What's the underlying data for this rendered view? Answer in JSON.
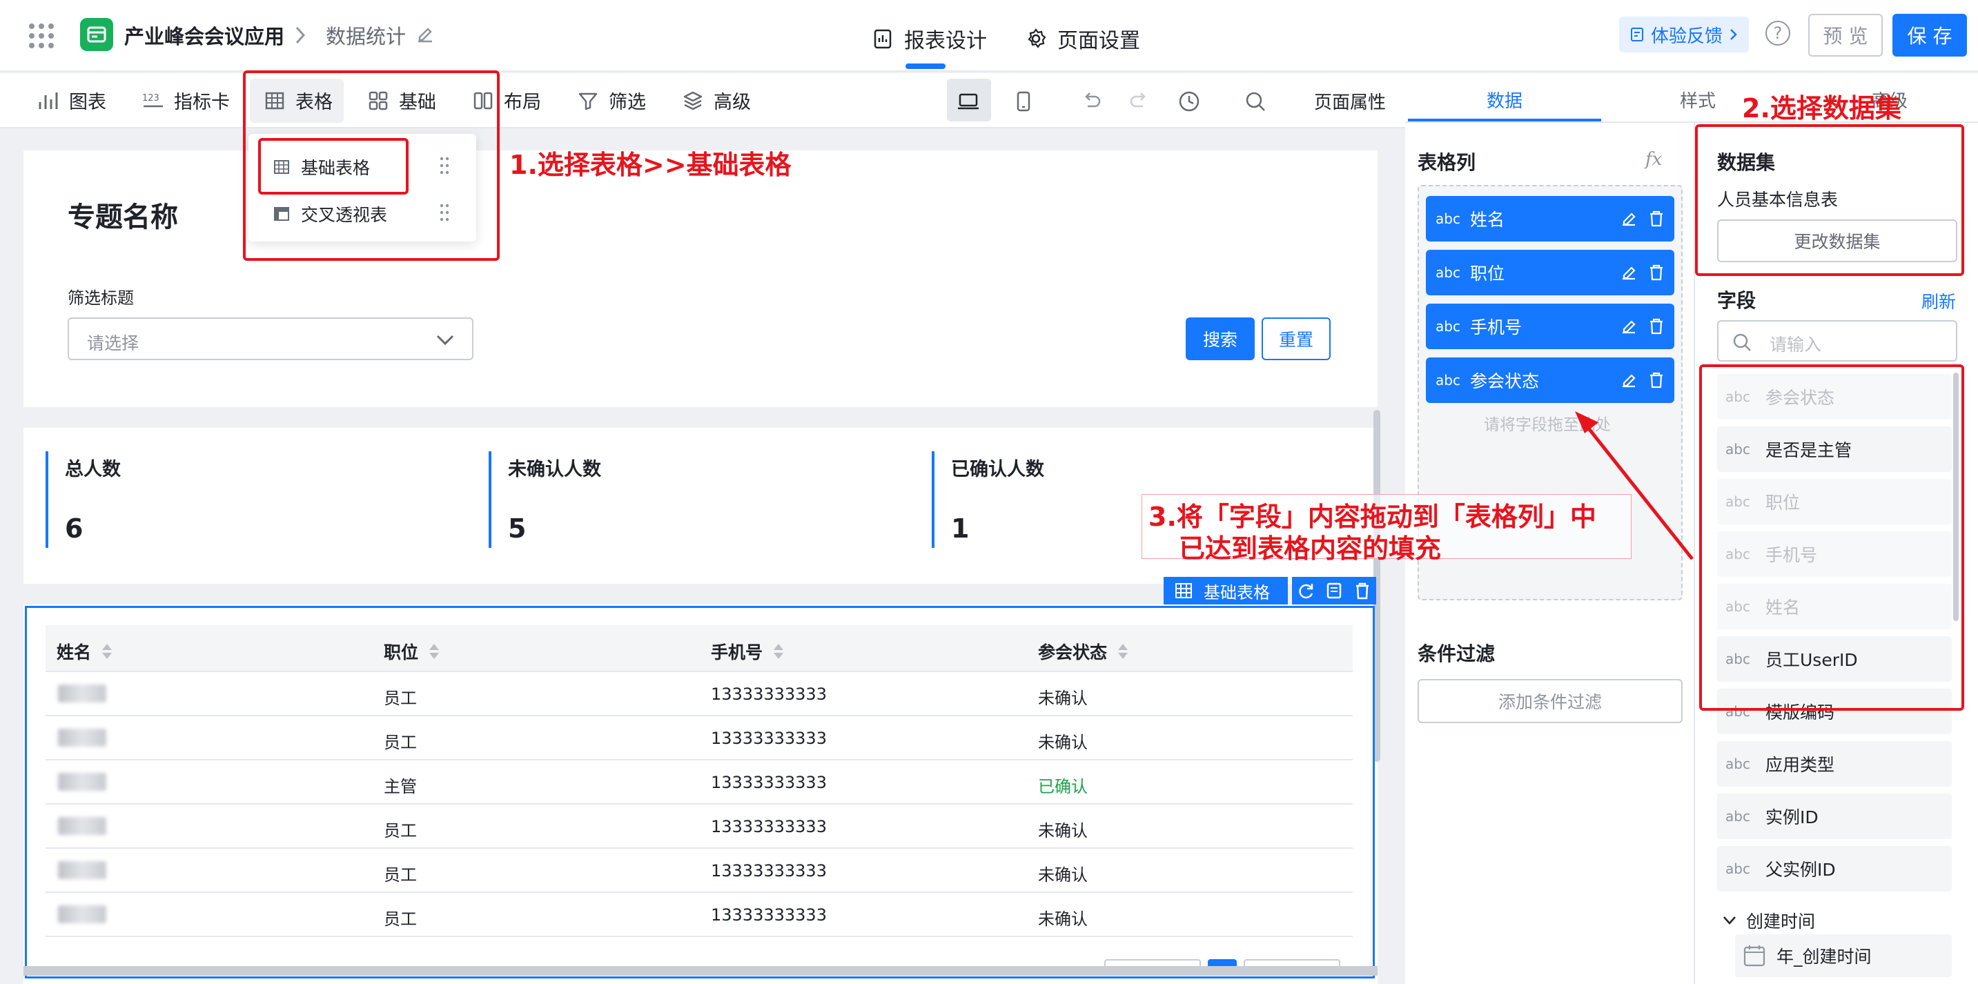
{
  "header": {
    "app_title": "产业峰会会议应用",
    "breadcrumb": "数据统计",
    "tabs": [
      {
        "label": "报表设计",
        "active": true
      },
      {
        "label": "页面设置",
        "active": false
      }
    ],
    "feedback": "体验反馈",
    "help": "?",
    "preview": "预 览",
    "save": "保 存"
  },
  "toolbar": {
    "items": [
      {
        "label": "图表",
        "icon": "bar-chart-icon"
      },
      {
        "label": "指标卡",
        "icon": "metric-123-icon"
      },
      {
        "label": "表格",
        "icon": "table-icon",
        "active": true
      },
      {
        "label": "基础",
        "icon": "basic-grid-icon"
      },
      {
        "label": "布局",
        "icon": "layout-icon"
      },
      {
        "label": "筛选",
        "icon": "filter-icon"
      },
      {
        "label": "高级",
        "icon": "layers-icon"
      }
    ],
    "page_props": "页面属性"
  },
  "table_menu": {
    "items": [
      {
        "label": "基础表格",
        "icon": "table-icon"
      },
      {
        "label": "交叉透视表",
        "icon": "pivot-table-icon"
      }
    ]
  },
  "canvas": {
    "topic": "专题名称",
    "filter": {
      "label": "筛选标题",
      "placeholder": "请选择",
      "search": "搜索",
      "reset": "重置"
    },
    "kpis": [
      {
        "title": "总人数",
        "value": "6"
      },
      {
        "title": "未确认人数",
        "value": "5"
      },
      {
        "title": "已确认人数",
        "value": "1"
      }
    ],
    "table_widget": {
      "label": "基础表格",
      "columns": [
        "姓名",
        "职位",
        "手机号",
        "参会状态"
      ],
      "rows": [
        {
          "position": "员工",
          "phone": "13333333333",
          "status": "未确认"
        },
        {
          "position": "员工",
          "phone": "13333333333",
          "status": "未确认"
        },
        {
          "position": "主管",
          "phone": "13333333333",
          "status": "已确认"
        },
        {
          "position": "员工",
          "phone": "13333333333",
          "status": "未确认"
        },
        {
          "position": "员工",
          "phone": "13333333333",
          "status": "未确认"
        },
        {
          "position": "员工",
          "phone": "13333333333",
          "status": "未确认"
        }
      ]
    }
  },
  "right_panel": {
    "tabs": [
      "数据",
      "样式",
      "高级"
    ],
    "table_columns": {
      "title": "表格列",
      "fx": "fx",
      "items": [
        {
          "type": "abc",
          "name": "姓名"
        },
        {
          "type": "abc",
          "name": "职位"
        },
        {
          "type": "abc",
          "name": "手机号"
        },
        {
          "type": "abc",
          "name": "参会状态"
        }
      ],
      "drop_hint": "请将字段拖至此处"
    },
    "condition_filter": {
      "title": "条件过滤",
      "add_button": "添加条件过滤"
    },
    "dataset": {
      "title": "数据集",
      "name": "人员基本信息表",
      "change_button": "更改数据集"
    },
    "fields": {
      "title": "字段",
      "refresh": "刷新",
      "search_placeholder": "请输入",
      "items": [
        {
          "type": "abc",
          "name": "参会状态",
          "disabled": true
        },
        {
          "type": "abc",
          "name": "是否是主管",
          "disabled": false
        },
        {
          "type": "abc",
          "name": "职位",
          "disabled": true
        },
        {
          "type": "abc",
          "name": "手机号",
          "disabled": true
        },
        {
          "type": "abc",
          "name": "姓名",
          "disabled": true
        },
        {
          "type": "abc",
          "name": "员工UserID",
          "disabled": false
        },
        {
          "type": "abc",
          "name": "模版编码",
          "disabled": false
        },
        {
          "type": "abc",
          "name": "应用类型",
          "disabled": false
        },
        {
          "type": "abc",
          "name": "实例ID",
          "disabled": false
        },
        {
          "type": "abc",
          "name": "父实例ID",
          "disabled": false
        }
      ],
      "group": "创建时间",
      "group_item": "年_创建时间"
    }
  },
  "annotations": {
    "step1": "1.选择表格>>基础表格",
    "step2": "2.选择数据集",
    "step3_line1": "3.将「字段」内容拖动到「表格列」中",
    "step3_line2": "已达到表格内容的填充"
  },
  "colors": {
    "primary": "#1677ff",
    "annotation_red": "#e8141d",
    "confirmed_green": "#1aa34a",
    "app_icon_green": "#19b05b"
  }
}
